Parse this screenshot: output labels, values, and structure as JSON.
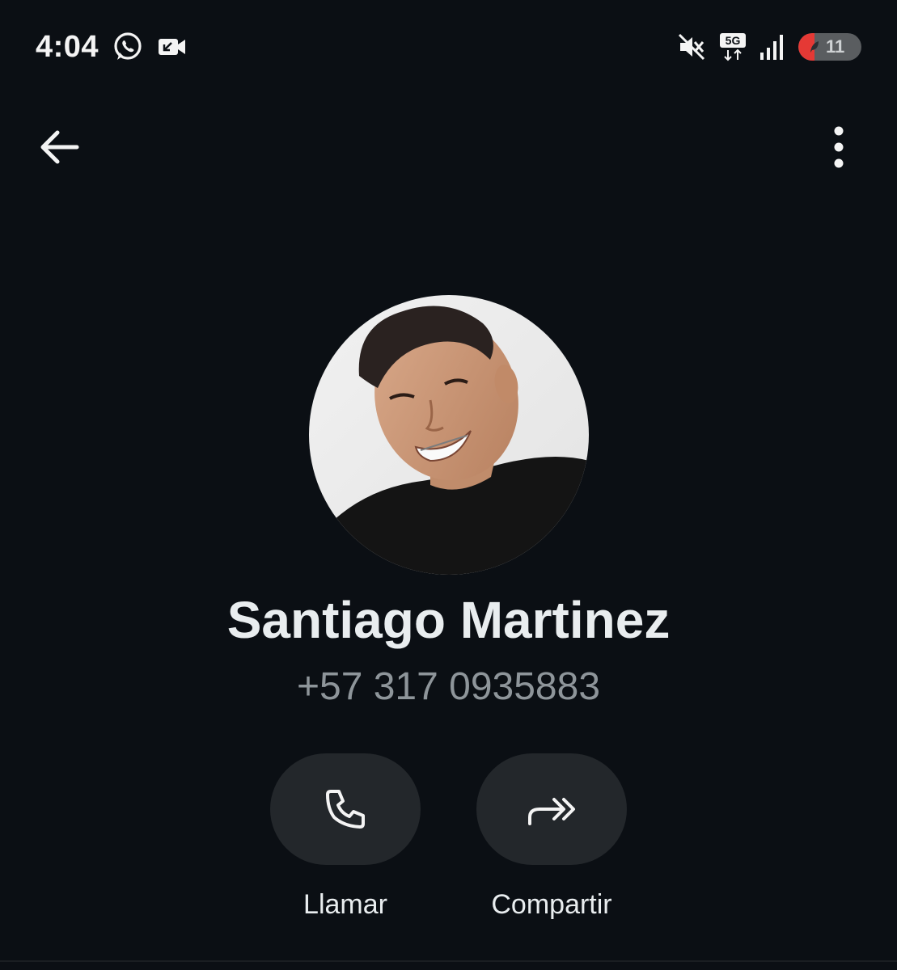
{
  "status_bar": {
    "time": "4:04",
    "battery_level": "11",
    "network": "5G",
    "icons": [
      "whatsapp-icon",
      "video-call-icon",
      "mute-icon",
      "5g-icon",
      "signal-icon",
      "battery-icon"
    ]
  },
  "header": {
    "back_icon": "back-arrow-icon",
    "menu_icon": "more-vert-icon"
  },
  "contact": {
    "name": "Santiago Martinez",
    "phone": "+57 317 0935883"
  },
  "actions": [
    {
      "label": "Llamar",
      "icon": "phone-icon"
    },
    {
      "label": "Compartir",
      "icon": "share-forward-icon"
    }
  ],
  "colors": {
    "background": "#0b0f14",
    "action_pill": "#23272b",
    "name_text": "#e9edef",
    "phone_text": "#8e959a",
    "battery_low": "#e53935"
  }
}
